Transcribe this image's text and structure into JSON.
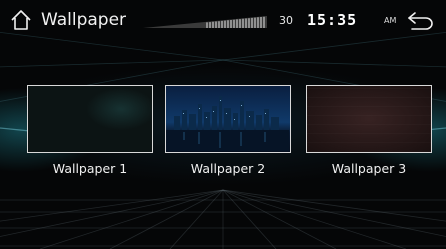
{
  "status_bar": {
    "title": "Wallpaper",
    "volume": "30",
    "time": "15:35",
    "ampm": "AM",
    "home_icon": "home-icon",
    "back_icon": "back-arrow-icon"
  },
  "wallpapers": [
    {
      "label": "Wallpaper 1"
    },
    {
      "label": "Wallpaper 2"
    },
    {
      "label": "Wallpaper 3"
    }
  ],
  "colors": {
    "background": "#050607",
    "accent_glow": "#28b4c8",
    "tile_border": "#d9d9d9"
  }
}
